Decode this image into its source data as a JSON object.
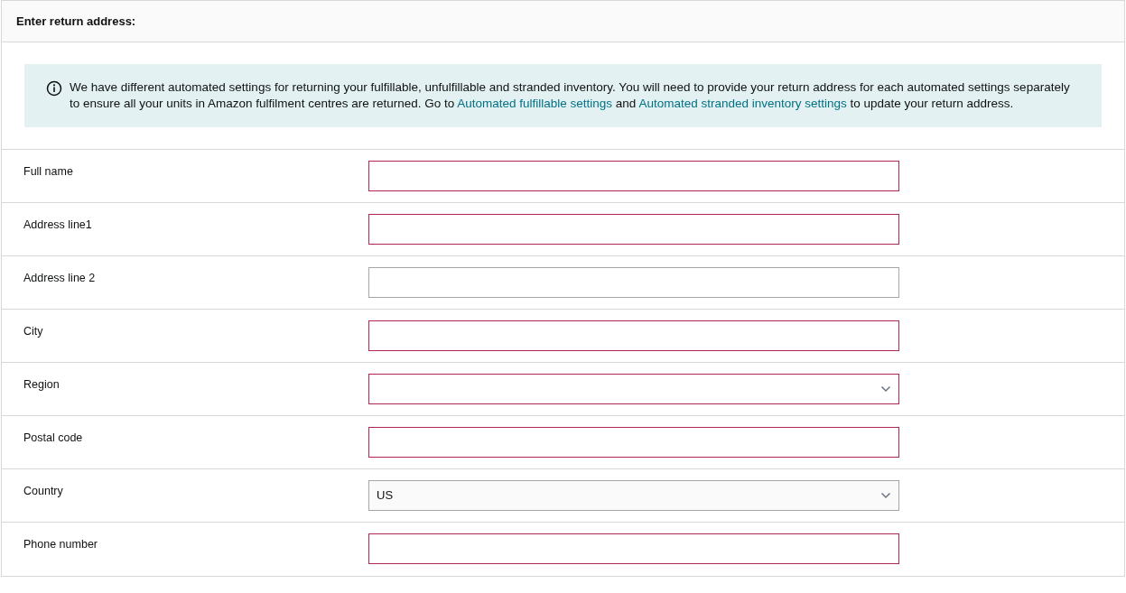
{
  "header": {
    "title": "Enter return address:"
  },
  "notice": {
    "segments": [
      {
        "kind": "text",
        "text": "We have different automated settings for returning your fulfillable, unfulfillable and stranded inventory. You will need to provide your return address for each automated settings separately to ensure all your units in Amazon fulfilment centres are returned. Go to "
      },
      {
        "kind": "link",
        "text": "Automated fulfillable settings"
      },
      {
        "kind": "text",
        "text": " and "
      },
      {
        "kind": "link",
        "text": "Automated stranded inventory settings"
      },
      {
        "kind": "text",
        "text": " to update your return address."
      }
    ]
  },
  "fields": [
    {
      "label": "Full name",
      "kind": "text",
      "invalid": true
    },
    {
      "label": "Address line1",
      "kind": "text",
      "invalid": true
    },
    {
      "label": "Address line 2",
      "kind": "text",
      "invalid": false
    },
    {
      "label": "City",
      "kind": "text",
      "invalid": true
    },
    {
      "label": "Region",
      "kind": "select",
      "invalid": true
    },
    {
      "label": "Postal code",
      "kind": "text",
      "invalid": true
    },
    {
      "label": "Country",
      "kind": "select",
      "invalid": false,
      "value": "US"
    },
    {
      "label": "Phone number",
      "kind": "text",
      "invalid": true
    }
  ]
}
